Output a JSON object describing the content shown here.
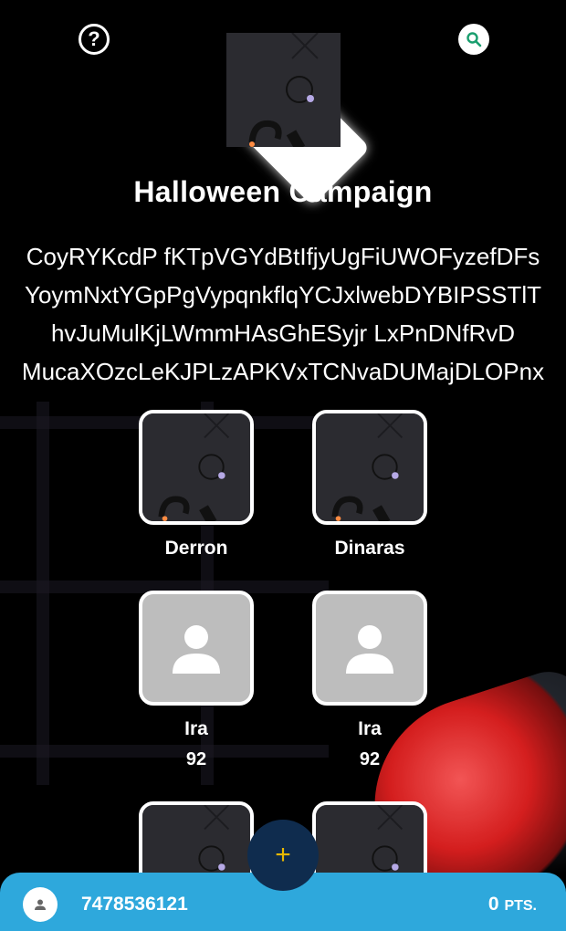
{
  "header": {
    "help_icon": "question-circle-icon",
    "search_icon": "search-icon"
  },
  "campaign": {
    "title": "Halloween Campaign",
    "description_lines": [
      "CoyRYKcdP fKTpVGYdBtIfjyUgFiUWOFyzefDFs",
      "YoymNxtYGpPgVypqnkflqYCJxlwebDYBIPSSTlT",
      "hvJuMulKjLWmmHAsGhESyjr LxPnDNfRvD",
      "MucaXOzcLeKJPLzAPKVxTCNvaDUMajDLOPnx"
    ]
  },
  "participants": [
    {
      "name": "Derron",
      "score": "",
      "image": "pattern"
    },
    {
      "name": "Dinaras",
      "score": "",
      "image": "pattern"
    },
    {
      "name": "Ira",
      "score": "92",
      "image": "person-icon"
    },
    {
      "name": "Ira",
      "score": "92",
      "image": "person-icon"
    },
    {
      "name": "",
      "score": "",
      "image": "pattern"
    },
    {
      "name": "",
      "score": "",
      "image": "pattern"
    }
  ],
  "fab": {
    "label": "+"
  },
  "footer": {
    "phone": "7478536121",
    "points_value": "0",
    "points_unit": "PTS."
  },
  "colors": {
    "footer_bg": "#2ea8dc",
    "fab_bg": "#0f2c4e",
    "fab_plus": "#e8b800",
    "search_icon": "#1a9e6e"
  }
}
